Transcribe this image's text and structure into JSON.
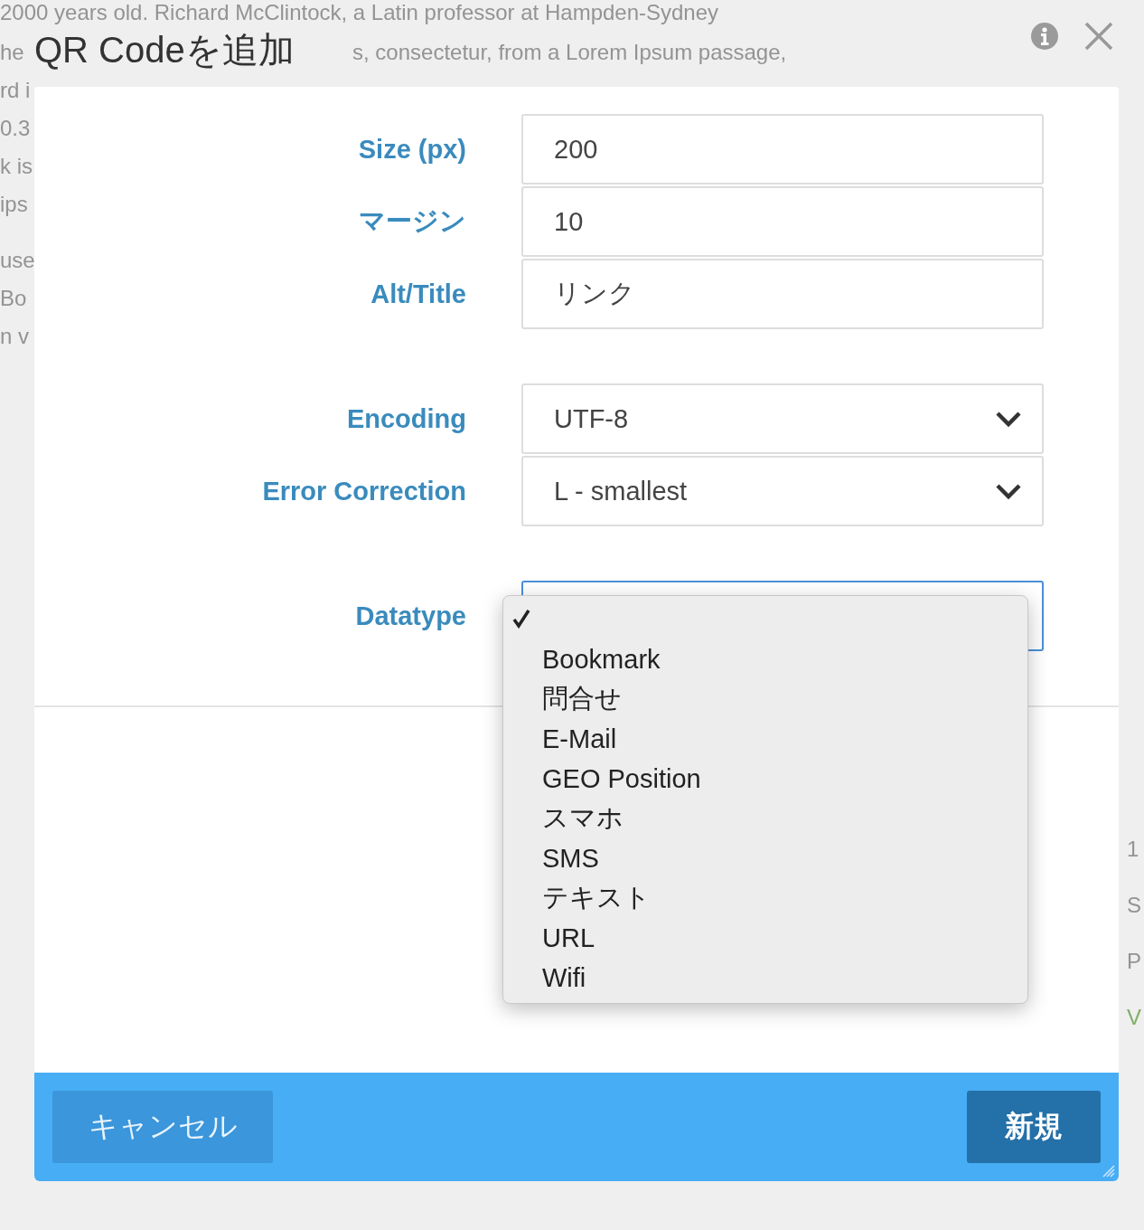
{
  "background_text": [
    {
      "text": "2000 years old. Richard McClintock, a Latin professor at Hampden-Sydney",
      "color": "#939393"
    },
    {
      "text": "he",
      "color": "#939393"
    },
    {
      "text": "s, consectetur, from a Lorem Ipsum passage,",
      "color": "#939393"
    },
    {
      "text": "rd i",
      "color": "#939393"
    },
    {
      "text": "0.3",
      "color": "#939393"
    },
    {
      "text": "k is",
      "color": "#939393"
    },
    {
      "text": "ips",
      "color": "#939393"
    },
    {
      "text": "use",
      "color": "#939393"
    },
    {
      "text": "Bo",
      "color": "#939393"
    },
    {
      "text": "n v",
      "color": "#939393"
    },
    {
      "text": "1",
      "color": "#939393"
    },
    {
      "text": "S",
      "color": "#939393"
    },
    {
      "text": "P",
      "color": "#939393"
    },
    {
      "text": "V",
      "color": "#7fae68"
    }
  ],
  "dialog": {
    "title": "QR Codeを追加",
    "field_groups": [
      [
        {
          "label": "Size (px)",
          "kind": "text",
          "value": "200"
        },
        {
          "label": "マージン",
          "kind": "text",
          "value": "10"
        },
        {
          "label": "Alt/Title",
          "kind": "text",
          "value": "リンク"
        }
      ],
      [
        {
          "label": "Encoding",
          "kind": "select",
          "value": "UTF-8"
        },
        {
          "label": "Error Correction",
          "kind": "select",
          "value": "L - smallest"
        }
      ],
      [
        {
          "label": "Datatype",
          "kind": "select",
          "focused": true,
          "expanded": true
        }
      ]
    ],
    "options": [
      {
        "selected": true
      },
      {
        "label": "Bookmark",
        "selected": false
      },
      {
        "label": "問合せ",
        "selected": false
      },
      {
        "label": "E-Mail",
        "selected": false
      },
      {
        "label": "GEO Position",
        "selected": false
      },
      {
        "label": "スマホ",
        "selected": false
      },
      {
        "label": "SMS",
        "selected": false
      },
      {
        "label": "テキスト",
        "selected": false
      },
      {
        "label": "URL",
        "selected": false
      },
      {
        "label": "Wifi",
        "selected": false
      }
    ],
    "buttons": [
      {
        "label": "キャンセル",
        "kind": "secondary"
      },
      {
        "label": "新規",
        "kind": "primary"
      }
    ]
  }
}
